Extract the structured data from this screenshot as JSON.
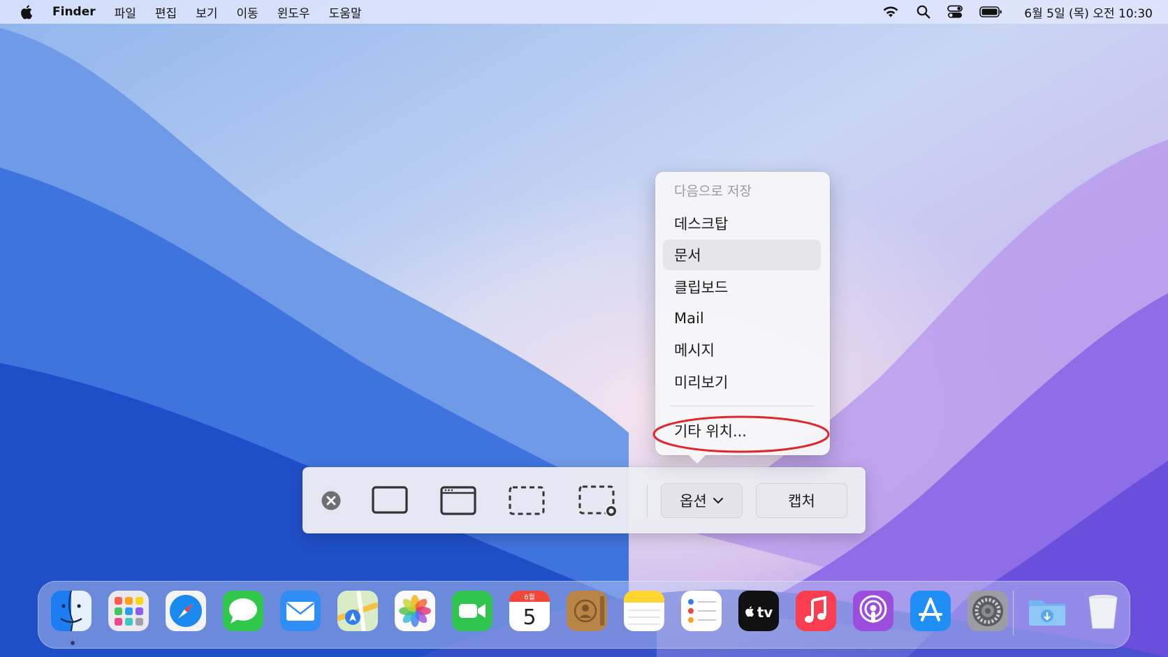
{
  "menubar": {
    "app_name": "Finder",
    "items": [
      "파일",
      "편집",
      "보기",
      "이동",
      "윈도우",
      "도움말"
    ],
    "clock": "6월 5일 (목) 오전 10:30"
  },
  "options_menu": {
    "header": "다음으로 저장",
    "items": [
      "데스크탑",
      "문서",
      "클립보드",
      "Mail",
      "메시지",
      "미리보기"
    ],
    "selected_item": "문서",
    "other_location": "기타 위치..."
  },
  "toolbar": {
    "options_label": "옵션",
    "capture_label": "캡처"
  },
  "dock": {
    "calendar_month": "6월",
    "calendar_day": "5",
    "tv_label": "tv"
  },
  "colors": {
    "accent_red": "#e0262c",
    "menu_selected": "#e6e6ea"
  }
}
